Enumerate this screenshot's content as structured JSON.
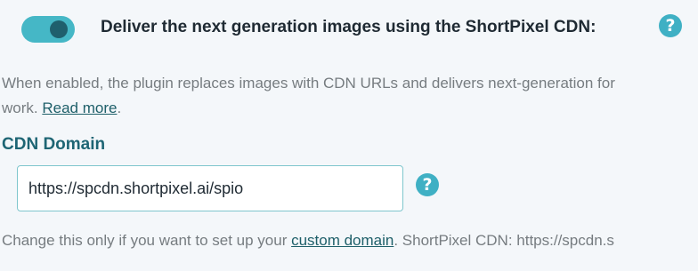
{
  "cdn_setting": {
    "toggle_state": "on",
    "title": "Deliver the next generation images using the ShortPixel CDN:",
    "help_icon": "question-mark-icon",
    "help_glyph": "?",
    "description_line1": "When enabled, the plugin replaces images with CDN URLs and delivers next-generation for",
    "description_line2_prefix": "work. ",
    "read_more_label": "Read more",
    "description_line2_suffix": "."
  },
  "cdn_domain": {
    "label": "CDN Domain",
    "value": "https://spcdn.shortpixel.ai/spio",
    "help_glyph": "?",
    "help_prefix": "Change this only if you want to set up your ",
    "custom_domain_link": "custom domain",
    "help_suffix": ". ShortPixel CDN: https://spcdn.s"
  },
  "colors": {
    "accent": "#45b7c6",
    "knob": "#1f5f6d",
    "link": "#1e5f69",
    "label": "#1e6574",
    "background": "#f4f7fa"
  }
}
